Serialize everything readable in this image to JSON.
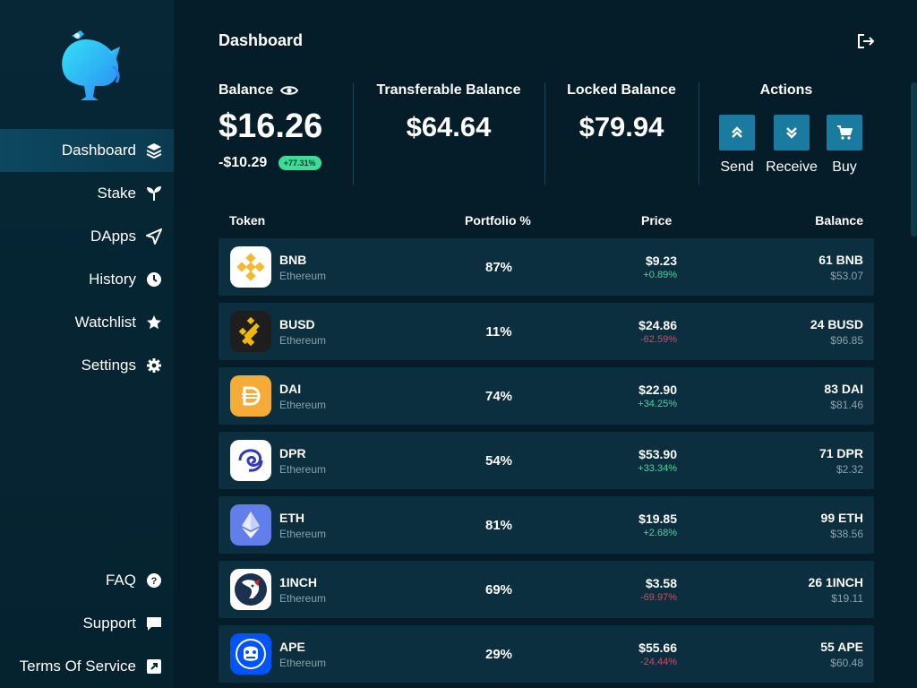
{
  "sidebar": {
    "items": [
      {
        "label": "Dashboard",
        "icon": "layers-icon",
        "active": true
      },
      {
        "label": "Stake",
        "icon": "sprout-icon"
      },
      {
        "label": "DApps",
        "icon": "send-icon"
      },
      {
        "label": "History",
        "icon": "clock-icon"
      },
      {
        "label": "Watchlist",
        "icon": "star-icon"
      },
      {
        "label": "Settings",
        "icon": "gear-icon"
      }
    ],
    "bottom": [
      {
        "label": "FAQ",
        "icon": "question-icon"
      },
      {
        "label": "Support",
        "icon": "chat-icon"
      },
      {
        "label": "Terms Of Service",
        "icon": "external-link-icon"
      }
    ]
  },
  "header": {
    "title": "Dashboard",
    "logout_icon": "logout-icon"
  },
  "balance": {
    "label": "Balance",
    "value": "$16.26",
    "change": "-$10.29",
    "change_pct": "+77.31%"
  },
  "transferable": {
    "label": "Transferable Balance",
    "value": "$64.64"
  },
  "locked": {
    "label": "Locked Balance",
    "value": "$79.94"
  },
  "actions": {
    "label": "Actions",
    "send": "Send",
    "receive": "Receive",
    "buy": "Buy"
  },
  "table": {
    "headers": {
      "token": "Token",
      "portfolio": "Portfolio %",
      "price": "Price",
      "balance": "Balance"
    },
    "rows": [
      {
        "name": "BNB",
        "network": "Ethereum",
        "portfolio": "87%",
        "price": "$9.23",
        "change": "+0.89%",
        "dir": "up",
        "balance": "61 BNB",
        "balance_usd": "$53.07",
        "icon": "bnb-icon"
      },
      {
        "name": "BUSD",
        "network": "Ethereum",
        "portfolio": "11%",
        "price": "$24.86",
        "change": "-62.59%",
        "dir": "down",
        "balance": "24 BUSD",
        "balance_usd": "$96.85",
        "icon": "busd-icon"
      },
      {
        "name": "DAI",
        "network": "Ethereum",
        "portfolio": "74%",
        "price": "$22.90",
        "change": "+34.25%",
        "dir": "up",
        "balance": "83 DAI",
        "balance_usd": "$81.46",
        "icon": "dai-icon"
      },
      {
        "name": "DPR",
        "network": "Ethereum",
        "portfolio": "54%",
        "price": "$53.90",
        "change": "+33.34%",
        "dir": "up",
        "balance": "71 DPR",
        "balance_usd": "$2.32",
        "icon": "dpr-icon"
      },
      {
        "name": "ETH",
        "network": "Ethereum",
        "portfolio": "81%",
        "price": "$19.85",
        "change": "+2.68%",
        "dir": "up",
        "balance": "99 ETH",
        "balance_usd": "$38.56",
        "icon": "eth-icon"
      },
      {
        "name": "1INCH",
        "network": "Ethereum",
        "portfolio": "69%",
        "price": "$3.58",
        "change": "-69.97%",
        "dir": "down",
        "balance": "26 1INCH",
        "balance_usd": "$19.11",
        "icon": "1inch-icon"
      },
      {
        "name": "APE",
        "network": "Ethereum",
        "portfolio": "29%",
        "price": "$55.66",
        "change": "-24.44%",
        "dir": "down",
        "balance": "55 APE",
        "balance_usd": "$60.48",
        "icon": "ape-icon"
      }
    ]
  }
}
